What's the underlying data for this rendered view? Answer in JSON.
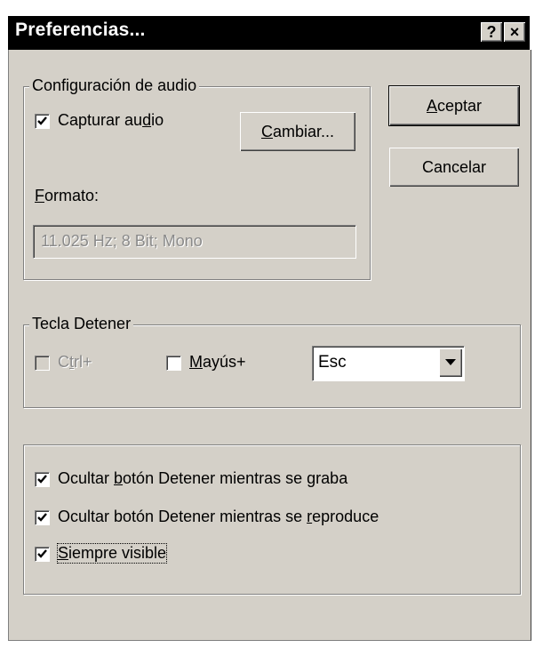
{
  "dialog": {
    "title": "Preferencias...",
    "help_button": "?",
    "close_button": "×"
  },
  "audio_group": {
    "legend": "Configuración de audio",
    "capture_audio": {
      "label_pre": "Capturar au",
      "label_key": "d",
      "label_post": "io",
      "checked": true
    },
    "change_button": {
      "key": "C",
      "rest": "ambiar..."
    },
    "format_label": {
      "key": "F",
      "rest": "ormato:"
    },
    "format_value": "11.025 Hz; 8 Bit; Mono"
  },
  "buttons": {
    "accept": {
      "key": "A",
      "rest": "ceptar"
    },
    "cancel": "Cancelar"
  },
  "stop_key_group": {
    "legend": "Tecla Detener",
    "ctrl": {
      "label_pre": "C",
      "label_key": "t",
      "label_post": "rl+",
      "checked": false,
      "enabled": false
    },
    "shift": {
      "label_key": "M",
      "label_post": "ayús+",
      "checked": false
    },
    "key_select": {
      "value": "Esc"
    }
  },
  "options_group": {
    "hide_while_recording": {
      "pre": "Ocultar ",
      "key": "b",
      "post": "otón Detener mientras se ",
      "key2": "g",
      "post2": "raba",
      "checked": true
    },
    "hide_while_playing": {
      "pre": "Ocultar botón Detener mientras se ",
      "key": "r",
      "post": "eproduce",
      "checked": true
    },
    "always_visible": {
      "key": "S",
      "post": "iempre visible",
      "checked": true
    }
  }
}
